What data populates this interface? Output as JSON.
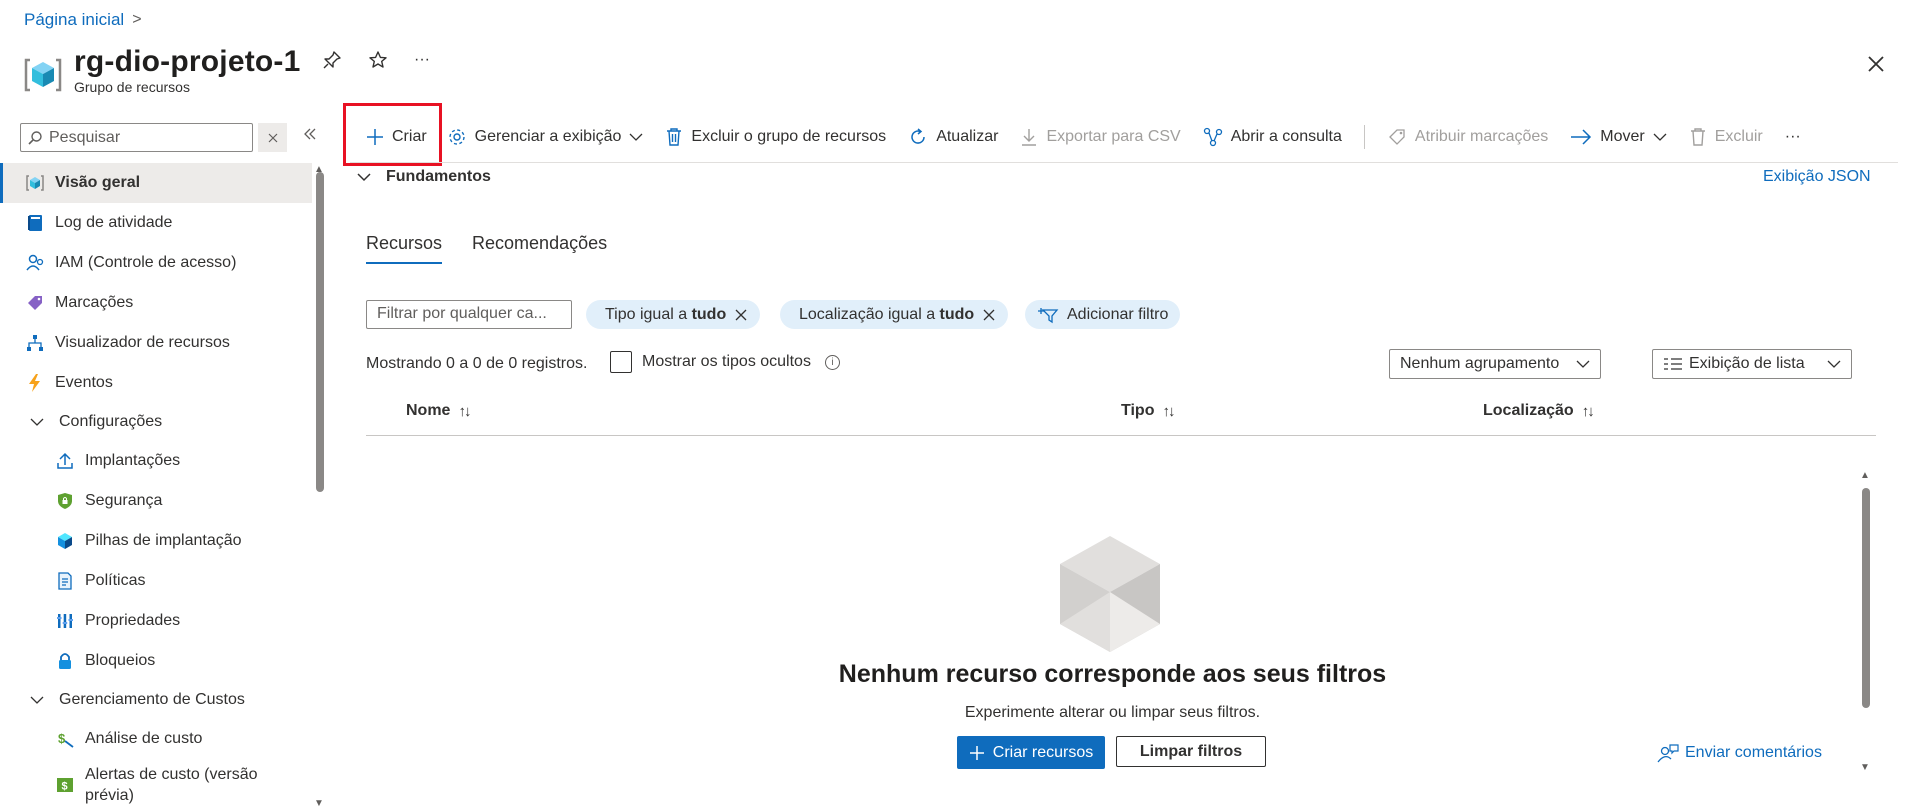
{
  "breadcrumb": {
    "home": "Página inicial",
    "sep": ">"
  },
  "header": {
    "title": "rg-dio-projeto-1",
    "subtitle": "Grupo de recursos",
    "more": "···"
  },
  "search": {
    "placeholder": "Pesquisar"
  },
  "sidebar": {
    "items": [
      {
        "label": "Visão geral",
        "icon": "overview-icon"
      },
      {
        "label": "Log de atividade",
        "icon": "activity-log-icon"
      },
      {
        "label": "IAM (Controle de acesso)",
        "icon": "iam-icon"
      },
      {
        "label": "Marcações",
        "icon": "tag-icon"
      },
      {
        "label": "Visualizador de recursos",
        "icon": "resource-visualizer-icon"
      },
      {
        "label": "Eventos",
        "icon": "lightning-icon"
      },
      {
        "label": "Configurações",
        "icon": "chevron-down-icon"
      },
      {
        "label": "Implantações",
        "icon": "upload-icon"
      },
      {
        "label": "Segurança",
        "icon": "shield-icon"
      },
      {
        "label": "Pilhas de implantação",
        "icon": "cube-stack-icon"
      },
      {
        "label": "Políticas",
        "icon": "policy-icon"
      },
      {
        "label": "Propriedades",
        "icon": "properties-icon"
      },
      {
        "label": "Bloqueios",
        "icon": "lock-icon"
      },
      {
        "label": "Gerenciamento de Custos",
        "icon": "chevron-down-icon"
      },
      {
        "label": "Análise de custo",
        "icon": "cost-analysis-icon"
      },
      {
        "label": "Alertas de custo (versão prévia)",
        "icon": "cost-alert-icon"
      }
    ]
  },
  "toolbar": {
    "create": "Criar",
    "manage_view": "Gerenciar a exibição",
    "delete_group": "Excluir o grupo de recursos",
    "refresh": "Atualizar",
    "export_csv": "Exportar para CSV",
    "open_query": "Abrir a consulta",
    "assign_tags": "Atribuir marcações",
    "move": "Mover",
    "delete": "Excluir",
    "more": "···"
  },
  "essentials": {
    "label": "Fundamentos",
    "json_view": "Exibição JSON"
  },
  "tabs": [
    {
      "label": "Recursos"
    },
    {
      "label": "Recomendações"
    }
  ],
  "filters": {
    "placeholder": "Filtrar por qualquer ca...",
    "type_prefix": "Tipo igual a ",
    "type_value": "tudo",
    "location_prefix": "Localização igual a ",
    "location_value": "tudo",
    "add_filter": "Adicionar filtro"
  },
  "records": "Mostrando 0 a 0 de 0 registros.",
  "show_hidden": "Mostrar os tipos ocultos",
  "grouping": "Nenhum agrupamento",
  "list_view": "Exibição de lista",
  "table": {
    "columns": [
      "Nome",
      "Tipo",
      "Localização"
    ],
    "rows": []
  },
  "empty": {
    "title": "Nenhum recurso corresponde aos seus filtros",
    "subtitle": "Experimente alterar ou limpar seus filtros.",
    "create": "Criar recursos",
    "clear": "Limpar filtros"
  },
  "feedback": "Enviar comentários",
  "colors": {
    "accent": "#0f6cbd",
    "highlight_box": "#e81123"
  }
}
